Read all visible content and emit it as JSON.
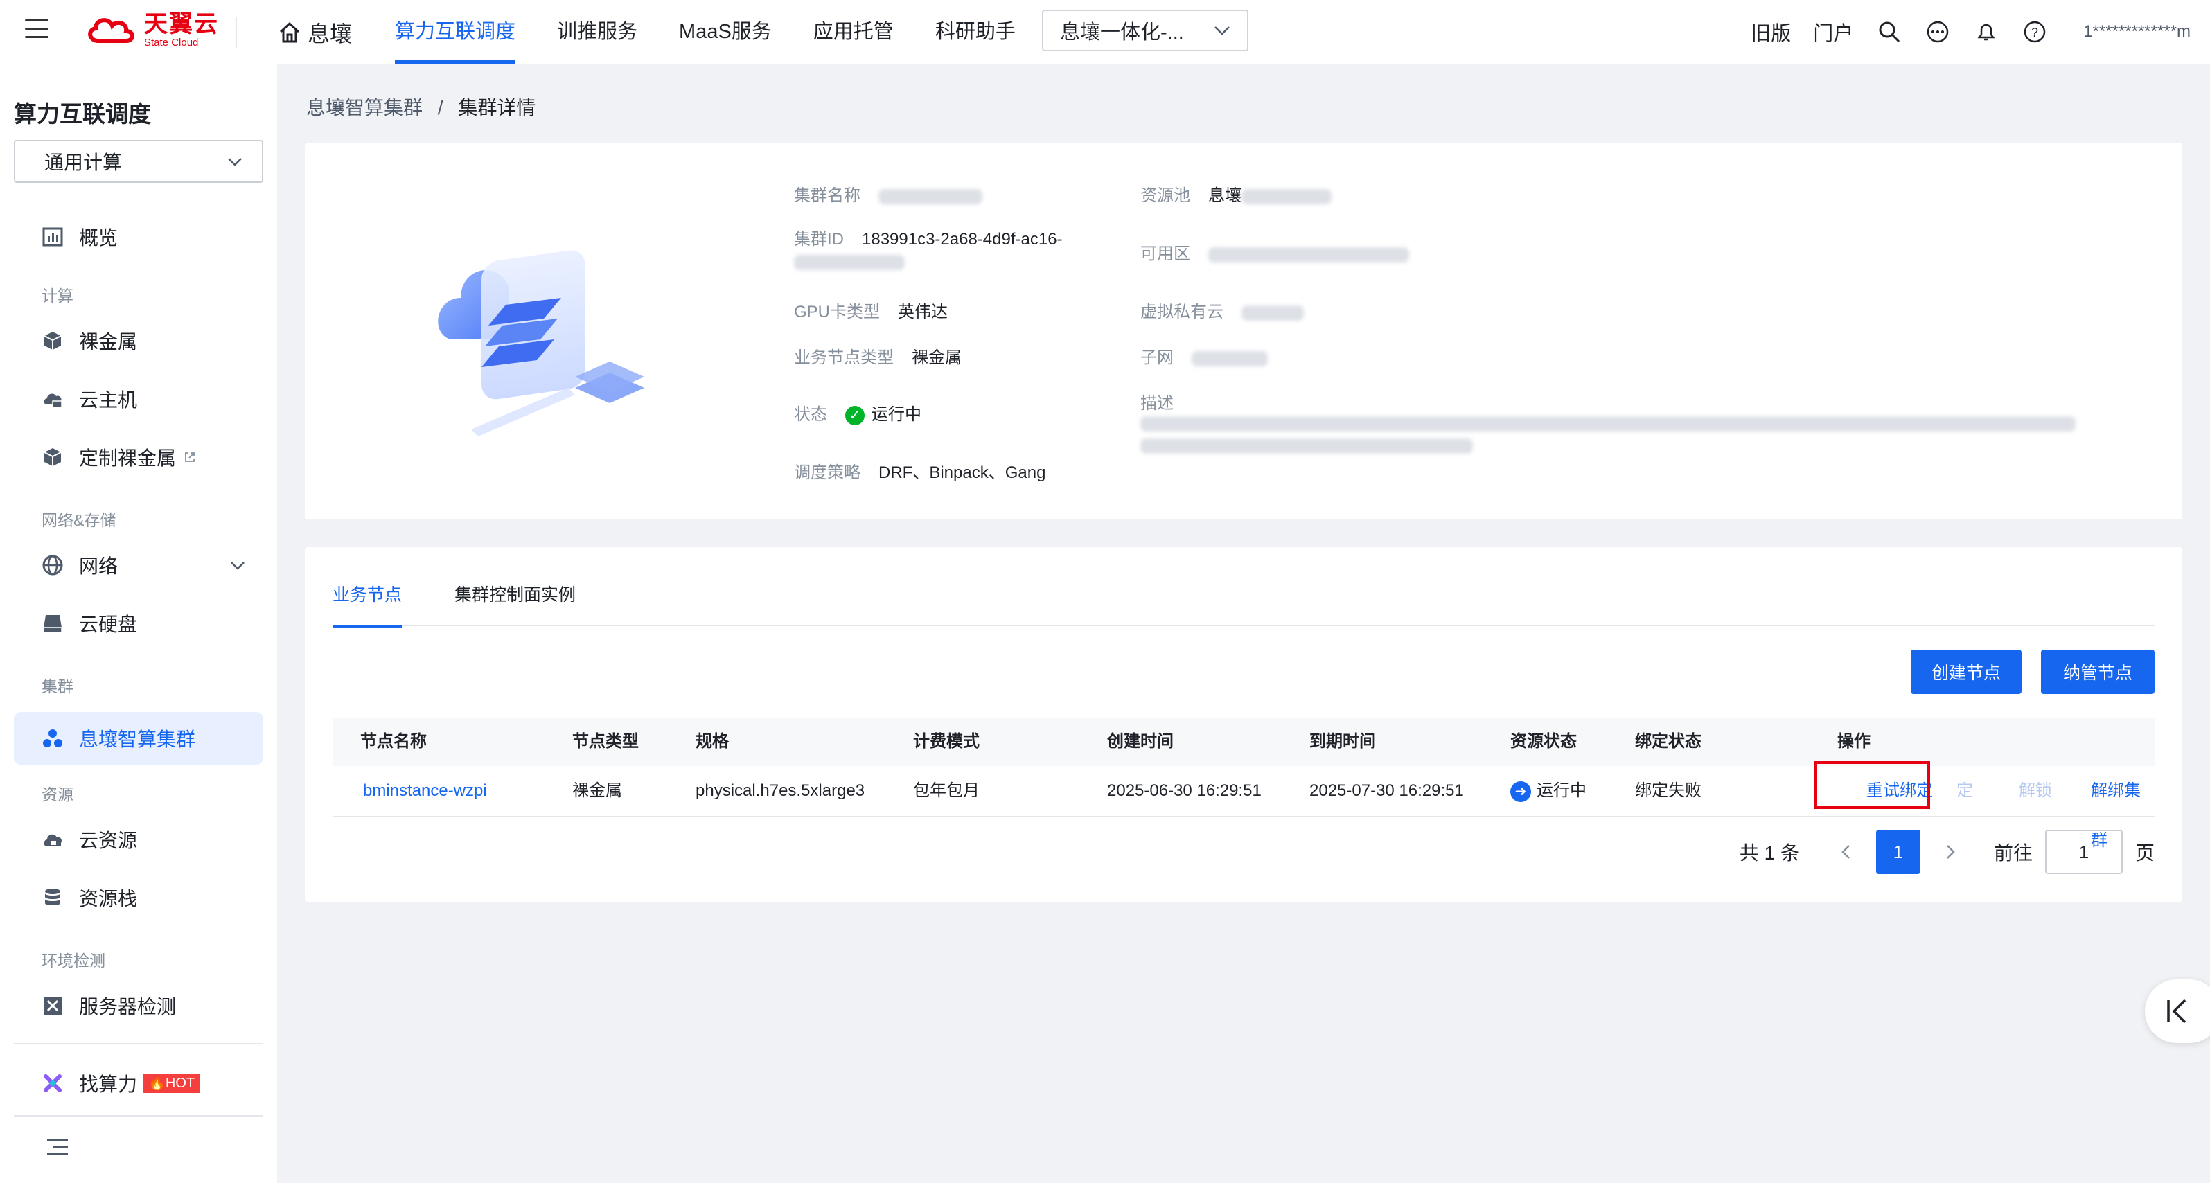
{
  "brand": {
    "cn": "天翼云",
    "en": "State Cloud",
    "color": "#e60012"
  },
  "topnav": {
    "home": "息壤",
    "items": [
      "算力互联调度",
      "训推服务",
      "MaaS服务",
      "应用托管",
      "科研助手"
    ],
    "active_index": 0,
    "selector": "息壤一体化-...",
    "right_links": [
      "旧版",
      "门户"
    ],
    "icons": [
      "search-icon",
      "message-icon",
      "bell-icon",
      "help-icon"
    ],
    "user": "1*************m"
  },
  "sidebar": {
    "title": "算力互联调度",
    "selector": "通用计算",
    "items": {
      "overview": "概览",
      "group_compute": "计算",
      "baremetal": "裸金属",
      "vm": "云主机",
      "custom_baremetal": "定制裸金属",
      "group_network": "网络&存储",
      "network": "网络",
      "disk": "云硬盘",
      "group_cluster": "集群",
      "cluster": "息壤智算集群",
      "group_resource": "资源",
      "cloud_resource": "云资源",
      "resource_stack": "资源栈",
      "group_env": "环境检测",
      "server_check": "服务器检测",
      "find_power": "找算力",
      "hot": "HOT"
    }
  },
  "breadcrumb": {
    "parent": "息壤智算集群",
    "sep": "/",
    "current": "集群详情"
  },
  "cluster": {
    "name_label": "集群名称",
    "id_label": "集群ID",
    "id_value": "183991c3-2a68-4d9f-ac16-",
    "gpu_label": "GPU卡类型",
    "gpu_value": "英伟达",
    "node_type_label": "业务节点类型",
    "node_type_value": "裸金属",
    "status_label": "状态",
    "status_value": "运行中",
    "policy_label": "调度策略",
    "policy_value": "DRF、Binpack、Gang",
    "pool_label": "资源池",
    "pool_value": "息壤",
    "zone_label": "可用区",
    "vpc_label": "虚拟私有云",
    "subnet_label": "子网",
    "desc_label": "描述"
  },
  "tabs": [
    "业务节点",
    "集群控制面实例"
  ],
  "actions": {
    "create": "创建节点",
    "manage": "纳管节点"
  },
  "table": {
    "columns": [
      "节点名称",
      "节点类型",
      "规格",
      "计费模式",
      "创建时间",
      "到期时间",
      "资源状态",
      "绑定状态",
      "操作"
    ],
    "rows": [
      {
        "name": "bminstance-wzpi",
        "type": "裸金属",
        "spec": "physical.h7es.5xlarge3",
        "billing": "包年包月",
        "created": "2025-06-30 16:29:51",
        "expires": "2025-07-30 16:29:51",
        "status": "运行中",
        "bind": "绑定失败",
        "ops": [
          "重试绑定",
          "绑定",
          "解锁",
          "解绑集群"
        ]
      }
    ]
  },
  "pager": {
    "total": "共 1 条",
    "page": "1",
    "goto": "前往",
    "input": "1",
    "suffix": "页"
  }
}
